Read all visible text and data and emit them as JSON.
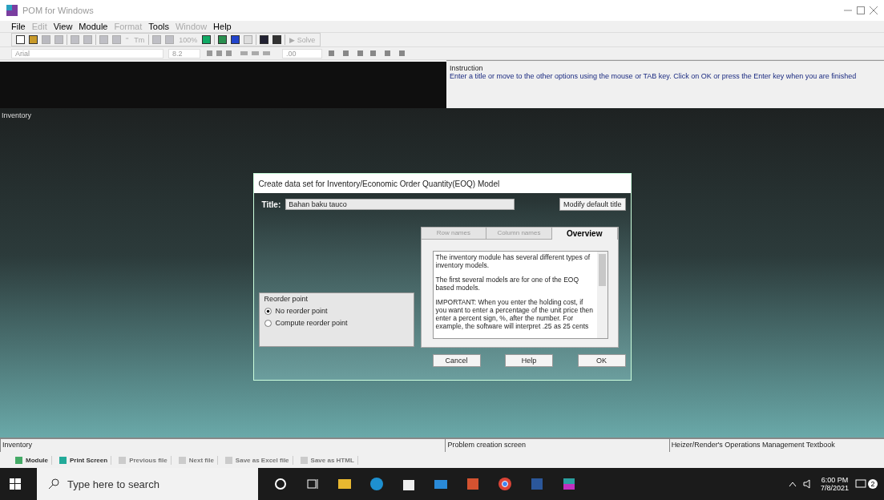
{
  "window": {
    "title": "POM for Windows"
  },
  "menu": [
    {
      "label": "File",
      "disabled": false
    },
    {
      "label": "Edit",
      "disabled": true
    },
    {
      "label": "View",
      "disabled": false
    },
    {
      "label": "Module",
      "disabled": false
    },
    {
      "label": "Format",
      "disabled": true
    },
    {
      "label": "Tools",
      "disabled": false
    },
    {
      "label": "Window",
      "disabled": true
    },
    {
      "label": "Help",
      "disabled": false
    }
  ],
  "toolbar": [
    {
      "kind": "icon",
      "disabled": false
    },
    {
      "kind": "icon",
      "disabled": false
    },
    {
      "kind": "icon",
      "disabled": true
    },
    {
      "kind": "icon",
      "disabled": true
    },
    {
      "kind": "sep"
    },
    {
      "kind": "icon",
      "disabled": true
    },
    {
      "kind": "icon",
      "disabled": true
    },
    {
      "kind": "sep"
    },
    {
      "kind": "icon",
      "disabled": true
    },
    {
      "kind": "icon",
      "disabled": true
    },
    {
      "kind": "text",
      "label": "\"",
      "disabled": true
    },
    {
      "kind": "text",
      "label": "Tm",
      "disabled": true
    },
    {
      "kind": "sep"
    },
    {
      "kind": "icon",
      "disabled": true
    },
    {
      "kind": "icon",
      "disabled": true
    },
    {
      "kind": "text",
      "label": "100%",
      "disabled": true
    },
    {
      "kind": "icon",
      "disabled": false
    },
    {
      "kind": "sep"
    },
    {
      "kind": "icon",
      "disabled": false
    },
    {
      "kind": "icon",
      "disabled": false
    },
    {
      "kind": "icon",
      "disabled": true
    },
    {
      "kind": "sep"
    },
    {
      "kind": "icon",
      "disabled": false
    },
    {
      "kind": "icon",
      "disabled": false
    },
    {
      "kind": "sep"
    },
    {
      "kind": "text",
      "label": "▶ Solve",
      "disabled": true
    }
  ],
  "format_bar": {
    "font": "Arial",
    "size": "8.2",
    "decimals": ".00"
  },
  "instruction": {
    "heading": "Instruction",
    "text": "Enter a title or move to the other options using the mouse or TAB key. Click on OK or press the Enter key when you are finished"
  },
  "workspace_label": "Inventory",
  "dialog": {
    "title": "Create data set for Inventory/Economic Order Quantity(EOQ) Model",
    "title_label": "Title:",
    "title_value": "Bahan baku tauco",
    "modify_button": "Modify default title",
    "tabs": [
      {
        "label": "Row names",
        "selected": false
      },
      {
        "label": "Column names",
        "selected": false
      },
      {
        "label": "Overview",
        "selected": true
      }
    ],
    "overview": [
      "The inventory module has several different types of inventory models.",
      "The first several models are for one of the EOQ based models.",
      "IMPORTANT: When you enter the holding cost, if you want to enter a percentage of the unit price then enter a percent sign, %, after the number. For example, the software will interpret .25 as 25 cents"
    ],
    "reorder": {
      "legend": "Reorder point",
      "options": [
        {
          "label": "No reorder point",
          "selected": true
        },
        {
          "label": "Compute reorder point",
          "selected": false
        }
      ]
    },
    "buttons": [
      "Cancel",
      "Help",
      "OK"
    ]
  },
  "status_bar": [
    "Inventory",
    "Problem creation screen",
    "Heizer/Render's Operations Management Textbook"
  ],
  "bottom_toolbar": [
    {
      "label": "Module",
      "disabled": false
    },
    {
      "label": "Print Screen",
      "disabled": false
    },
    {
      "label": "Previous file",
      "disabled": true
    },
    {
      "label": "Next file",
      "disabled": true
    },
    {
      "label": "Save as Excel file",
      "disabled": true
    },
    {
      "label": "Save as HTML",
      "disabled": true
    }
  ],
  "taskbar": {
    "search_placeholder": "Type here to search",
    "time": "6:00 PM",
    "date": "7/8/2021",
    "notifications": "2"
  }
}
